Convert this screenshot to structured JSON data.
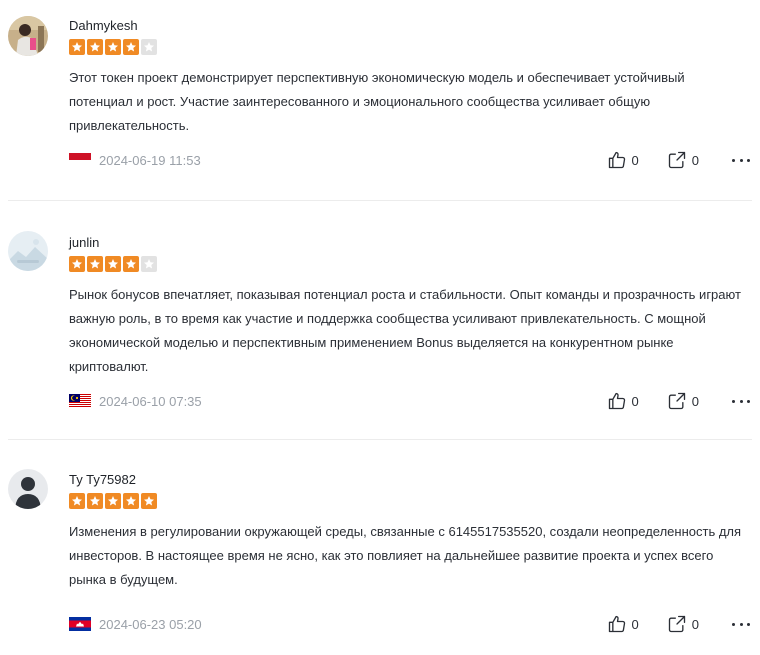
{
  "reviews": [
    {
      "username": "Dahmykesh",
      "rating": 4,
      "max_rating": 5,
      "text": "Этот токен проект демонстрирует перспективную экономическую модель и обеспечивает устойчивый потенциал и рост. Участие заинтересованного и эмоционального сообщества усиливает общую привлекательность.",
      "flag": "indonesia-flag",
      "date": "2024-06-19 11:53",
      "likes": "0",
      "shares": "0",
      "avatar": "user-photo-avatar"
    },
    {
      "username": "junlin",
      "rating": 4,
      "max_rating": 5,
      "text": "Рынок бонусов впечатляет, показывая потенциал роста и стабильности. Опыт команды и прозрачность играют важную роль, в то время как участие и поддержка сообщества усиливают привлекательность. С мощной экономической моделью и перспективным применением Bonus выделяется на конкурентном рынке криптовалют.",
      "flag": "malaysia-flag",
      "date": "2024-06-10 07:35",
      "likes": "0",
      "shares": "0",
      "avatar": "landscape-avatar"
    },
    {
      "username": "Ty Ty75982",
      "rating": 5,
      "max_rating": 5,
      "text": "Изменения в регулировании окружающей среды, связанные с 6145517535520, создали неопределенность для инвесторов. В настоящее время не ясно, как это повлияет на дальнейшее развитие проекта и успех всего рынка в будущем.",
      "flag": "cambodia-flag",
      "date": "2024-06-23 05:20",
      "likes": "0",
      "shares": "0",
      "avatar": "default-user-avatar"
    }
  ],
  "colors": {
    "star_on": "#f08a24",
    "star_off": "#e2e2e2",
    "muted_text": "#9aa0a8"
  }
}
